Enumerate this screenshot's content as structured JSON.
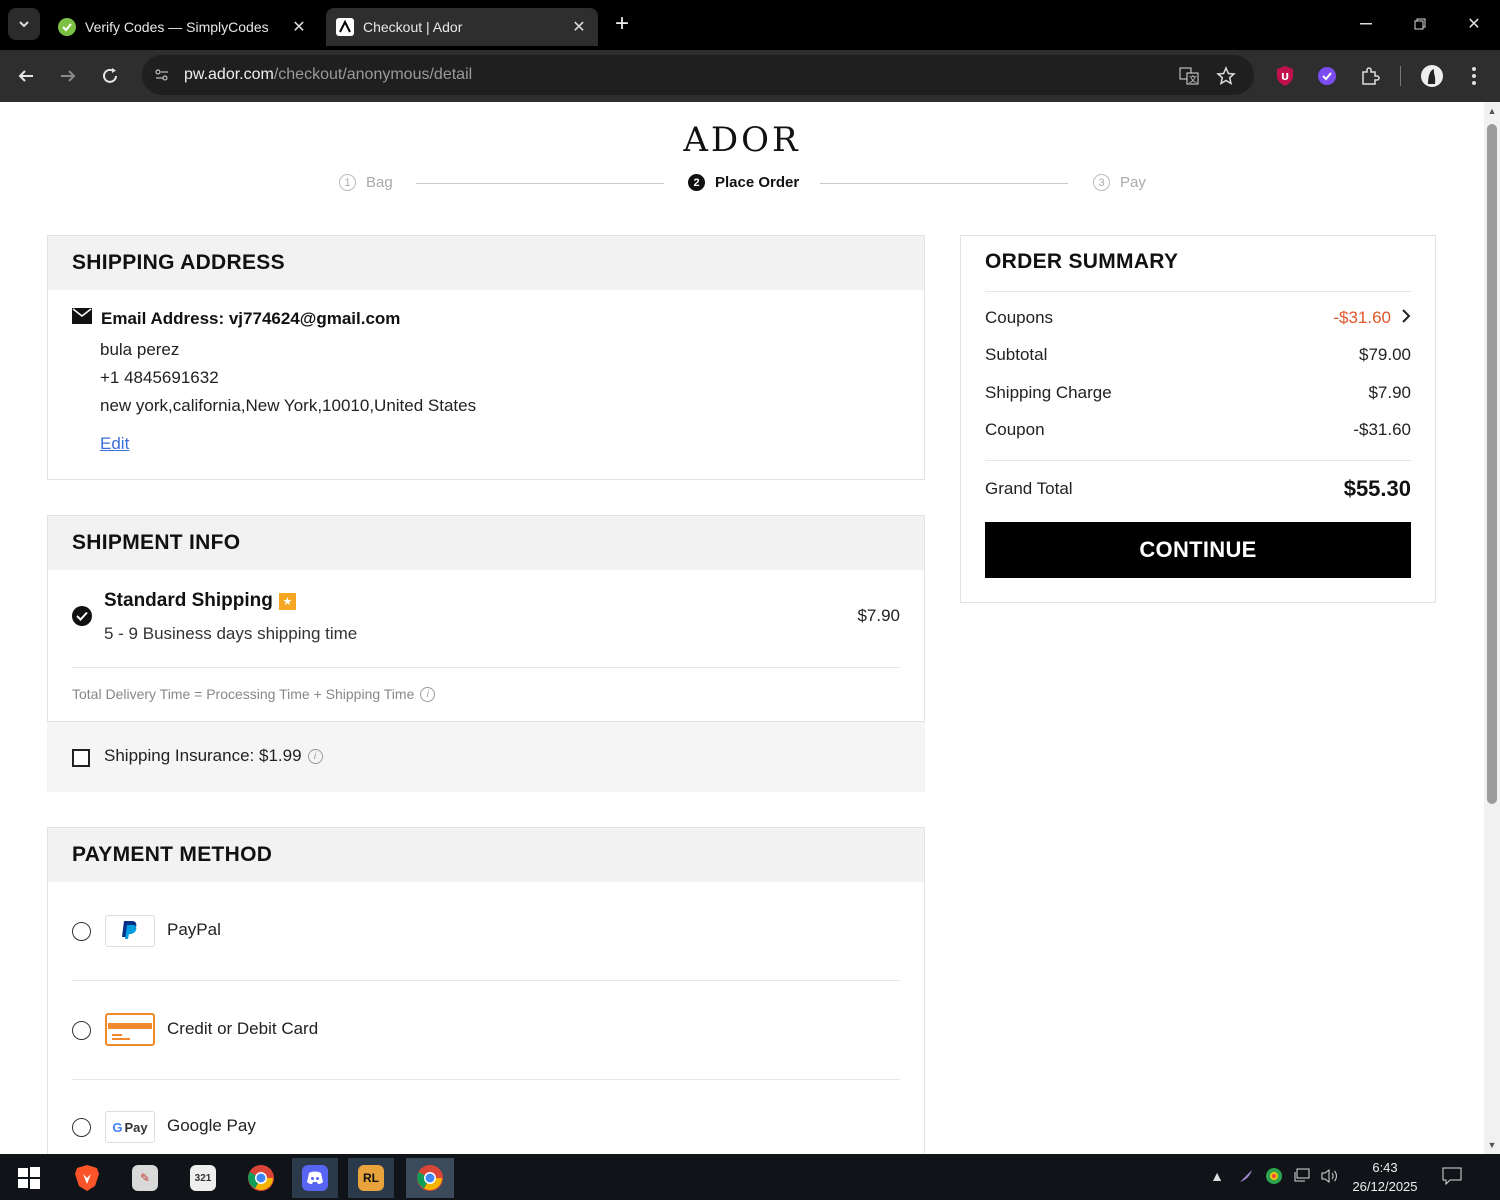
{
  "browser": {
    "tabs": [
      {
        "title": "Verify Codes — SimplyCodes",
        "active": false
      },
      {
        "title": "Checkout | Ador",
        "active": true
      }
    ],
    "url_host": "pw.ador.com",
    "url_path": "/checkout/anonymous/detail"
  },
  "brand": {
    "logo": "ADOR"
  },
  "steps": [
    {
      "num": "1",
      "label": "Bag"
    },
    {
      "num": "2",
      "label": "Place Order"
    },
    {
      "num": "3",
      "label": "Pay"
    }
  ],
  "shipping_address": {
    "heading": "SHIPPING ADDRESS",
    "email_label": "Email Address: vj774624@gmail.com",
    "name": "bula perez",
    "phone": "+1 4845691632",
    "address": "new york,california,New York,10010,United States",
    "edit_label": "Edit"
  },
  "shipment_info": {
    "heading": "SHIPMENT INFO",
    "method_name": "Standard Shipping",
    "method_desc": "5 - 9 Business days shipping time",
    "method_price": "$7.90",
    "delivery_note": "Total Delivery Time = Processing Time + Shipping Time",
    "insurance_label": "Shipping Insurance: $1.99"
  },
  "payment_method": {
    "heading": "PAYMENT METHOD",
    "options": [
      {
        "label": "PayPal",
        "icon": "paypal-icon"
      },
      {
        "label": "Credit or Debit Card",
        "icon": "credit-card-icon"
      },
      {
        "label": "Google Pay",
        "icon": "google-pay-icon"
      }
    ]
  },
  "order_summary": {
    "heading": "ORDER SUMMARY",
    "rows": [
      {
        "label": "Coupons",
        "value": "-$31.60"
      },
      {
        "label": "Subtotal",
        "value": "$79.00"
      },
      {
        "label": "Shipping Charge",
        "value": "$7.90"
      },
      {
        "label": "Coupon",
        "value": "-$31.60"
      }
    ],
    "grand_total_label": "Grand Total",
    "grand_total_value": "$55.30",
    "continue_label": "CONTINUE"
  },
  "taskbar": {
    "time": "6:43",
    "date": "26/12/2025"
  },
  "colors": {
    "accent_negative": "#e0562b",
    "button": "#000000",
    "link": "#3b6dd6",
    "badge": "#f5a623"
  }
}
